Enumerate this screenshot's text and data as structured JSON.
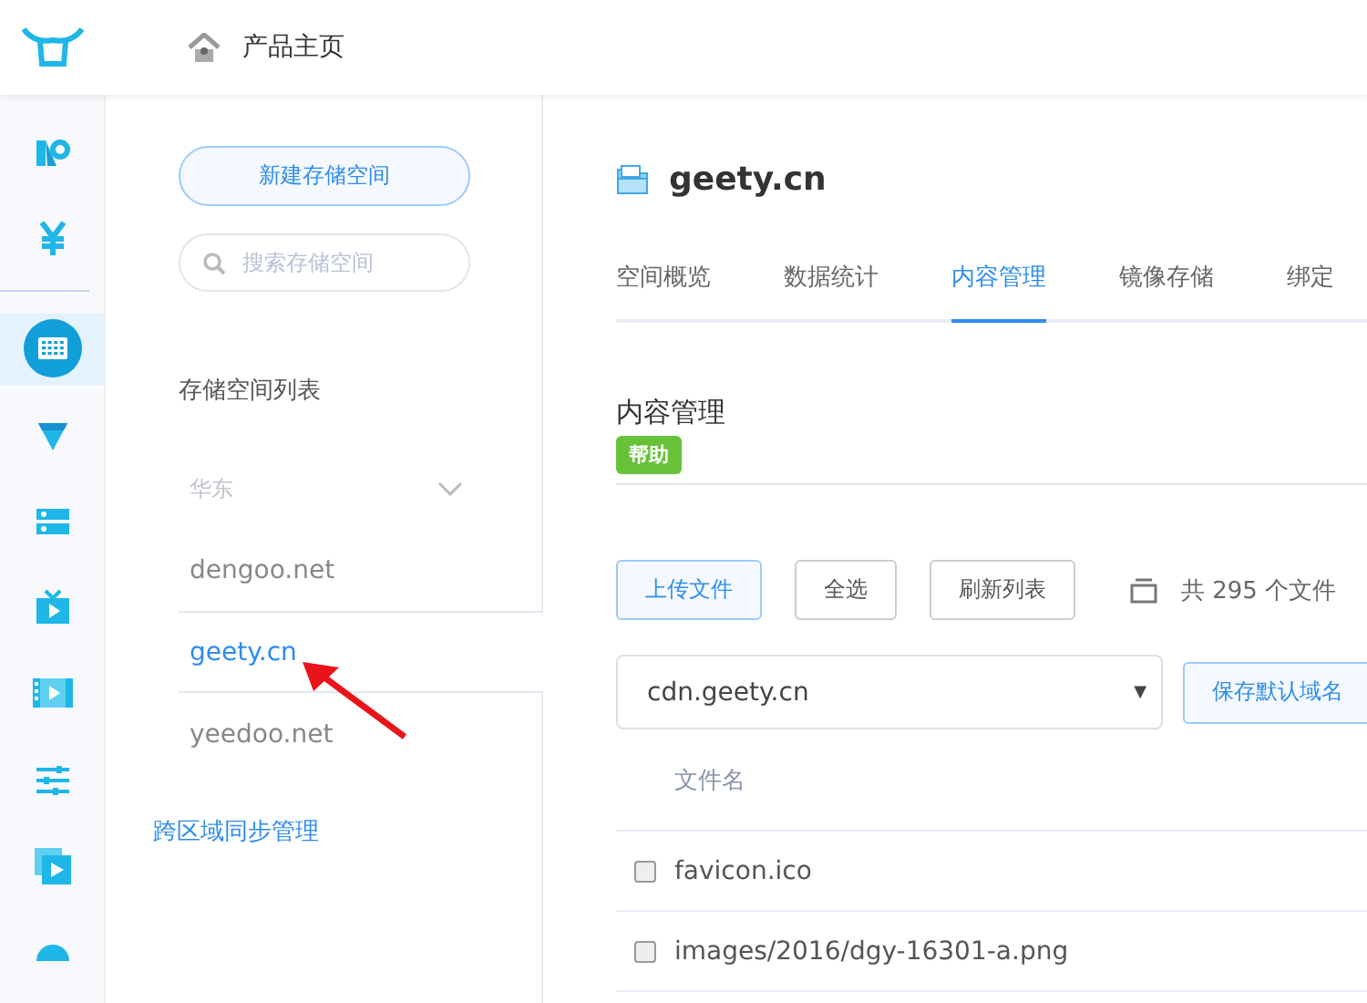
{
  "top_bar": {
    "title": "产品主页"
  },
  "rail": [
    {
      "kind": "cdn",
      "selected": false
    },
    {
      "kind": "yen",
      "selected": false
    },
    {
      "kind": "storage",
      "selected": true
    },
    {
      "kind": "funnel",
      "selected": false
    },
    {
      "kind": "list",
      "selected": false
    },
    {
      "kind": "tv",
      "selected": false
    },
    {
      "kind": "film",
      "selected": false
    },
    {
      "kind": "sliders",
      "selected": false
    },
    {
      "kind": "play",
      "selected": false
    },
    {
      "kind": "dot",
      "selected": false
    }
  ],
  "sidebar": {
    "new_button": "新建存储空间",
    "search": {
      "placeholder": "搜索存储空间"
    },
    "list_title": "存储空间列表",
    "region": {
      "label": "华东",
      "expanded": true
    },
    "buckets": [
      {
        "name": "dengoo.net",
        "selected": false
      },
      {
        "name": "geety.cn",
        "selected": true
      },
      {
        "name": "yeedoo.net",
        "selected": false
      }
    ],
    "sync_link": "跨区域同步管理"
  },
  "main": {
    "bucket_title": "geety.cn",
    "tabs": [
      {
        "label": "空间概览",
        "selected": false
      },
      {
        "label": "数据统计",
        "selected": false
      },
      {
        "label": "内容管理",
        "selected": true
      },
      {
        "label": "镜像存储",
        "selected": false
      },
      {
        "label": "绑定",
        "selected": false
      }
    ],
    "section_title": "内容管理",
    "help_badge": "帮助",
    "toolbar": [
      {
        "label": "上传文件",
        "kind": "primary"
      },
      {
        "label": "全选",
        "kind": "default"
      },
      {
        "label": "刷新列表",
        "kind": "default"
      }
    ],
    "file_count": "共 295 个文件",
    "domain_select": {
      "value": "cdn.geety.cn",
      "arrow": "▼"
    },
    "save_button": "保存默认域名",
    "table": {
      "columns": [
        "文件名"
      ],
      "rows": [
        {
          "name": "favicon.ico",
          "checked": false
        },
        {
          "name": "images/2016/dgy-16301-a.png",
          "checked": false
        }
      ]
    }
  }
}
